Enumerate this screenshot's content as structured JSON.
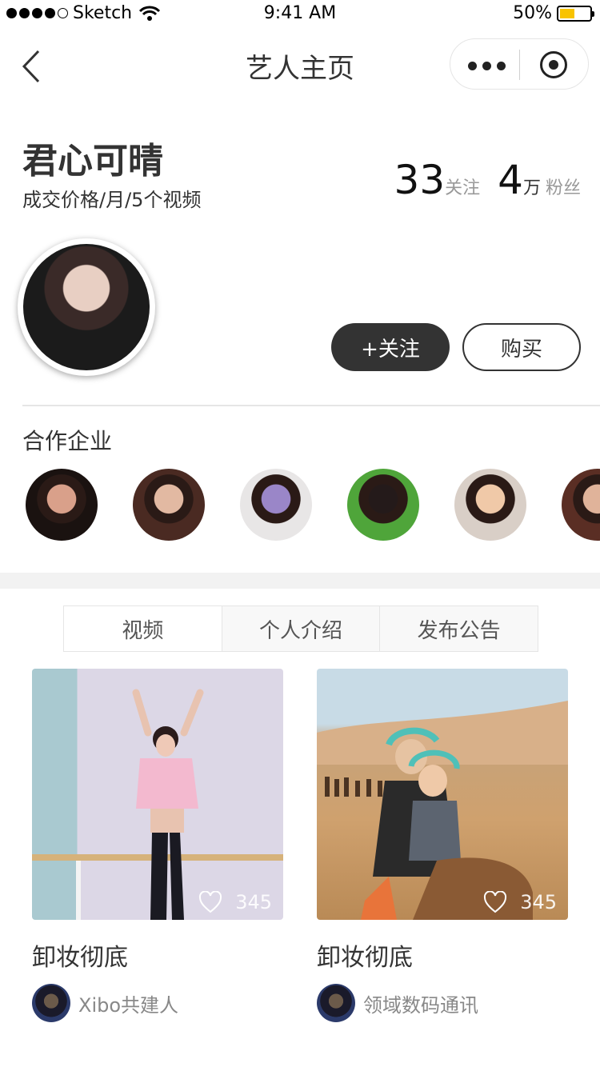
{
  "status_bar": {
    "carrier": "Sketch",
    "time": "9:41 AM",
    "battery_text": "50%",
    "battery_level": 0.5,
    "battery_color": "#f8c300"
  },
  "nav": {
    "title": "艺人主页",
    "back_icon": "chevron-left-icon",
    "more_icon": "more-dots-icon",
    "close_icon": "target-circle-icon"
  },
  "artist": {
    "name": "君心可晴",
    "subtitle": "成交价格/月/5个视频",
    "following_count": "33",
    "following_label": "关注",
    "fans_count": "4",
    "fans_unit": "万",
    "fans_label": "粉丝",
    "follow_button": "+关注",
    "buy_button": "购买"
  },
  "cooperation": {
    "title": "合作企业",
    "logos": [
      {
        "bg": "#1a1210",
        "face": "#d9a08a"
      },
      {
        "bg": "#4a2a22",
        "face": "#e2b9a2"
      },
      {
        "bg": "#e8e6e6",
        "face": "#9a86c8"
      },
      {
        "bg": "#4fa53a",
        "face": "#241a1a"
      },
      {
        "bg": "#d9cfc7",
        "face": "#f0c9a8"
      },
      {
        "bg": "#5a2e24",
        "face": "#e0b39a"
      }
    ]
  },
  "tabs": [
    {
      "label": "视频",
      "active": true
    },
    {
      "label": "个人介绍",
      "active": false
    },
    {
      "label": "发布公告",
      "active": false
    }
  ],
  "videos": [
    {
      "title": "卸妆彻底",
      "likes": "345",
      "author": "Xibo共建人",
      "scene": "ballet"
    },
    {
      "title": "卸妆彻底",
      "likes": "345",
      "author": "领域数码通讯",
      "scene": "desert"
    }
  ]
}
